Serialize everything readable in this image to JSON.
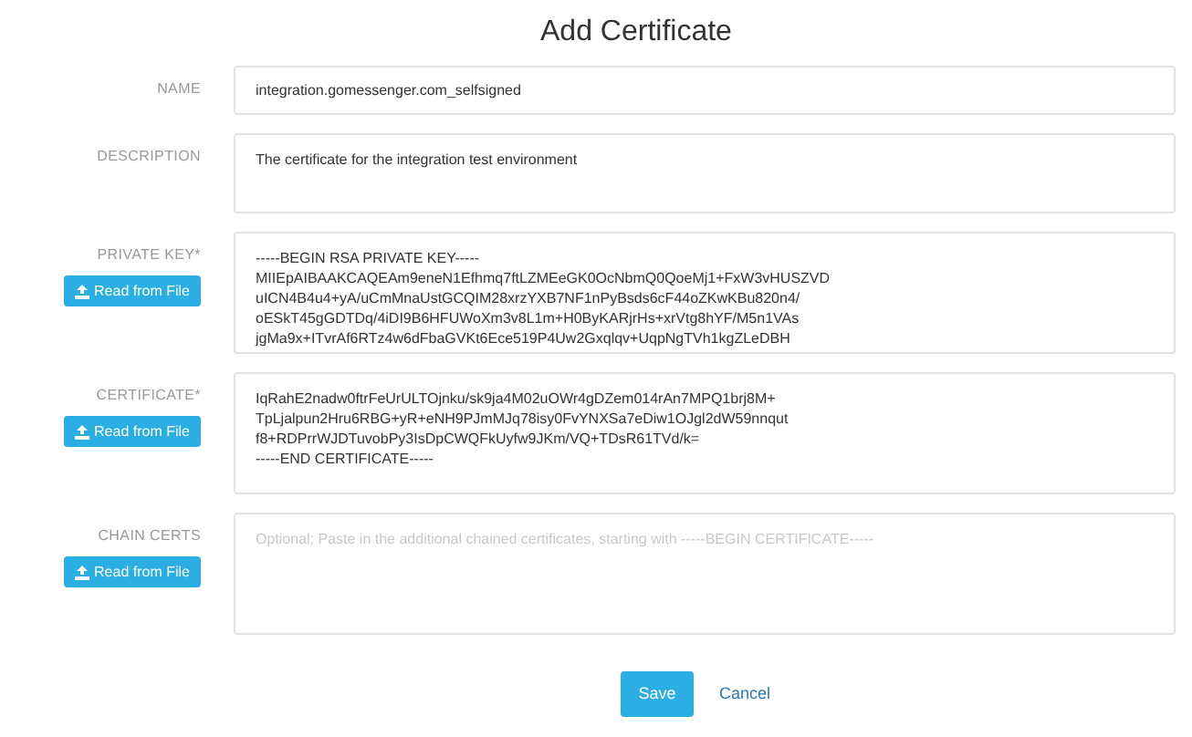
{
  "title": "Add Certificate",
  "fields": [
    {
      "label": "NAME",
      "kind": "line",
      "value": "integration.gomessenger.com_selfsigned"
    },
    {
      "label": "DESCRIPTION",
      "kind": "area",
      "value": "The certificate for the integration test environment"
    },
    {
      "label": "PRIVATE KEY*",
      "kind": "file",
      "button": "Read from File",
      "value": "-----BEGIN RSA PRIVATE KEY-----\nMIIEpAIBAAKCAQEAm9eneN1Efhmq7ftLZMEeGK0OcNbmQ0QoeMj1+FxW3vHUSZVD\nuICN4B4u4+yA/uCmMnaUstGCQIM28xrzYXB7NF1nPyBsds6cF44oZKwKBu820n4/\noESkT45gGDTDq/4iDI9B6HFUWoXm3v8L1m+H0ByKARjrHs+xrVtg8hYF/M5n1VAs\njgMa9x+ITvrAf6RTz4w6dFbaGVKt6Ece519P4Uw2Gxqlqv+UqpNgTVh1kgZLeDBH"
    },
    {
      "label": "CERTIFICATE*",
      "kind": "file",
      "button": "Read from File",
      "value": "IqRahE2nadw0ftrFeUrULTOjnku/sk9ja4M02uOWr4gDZem014rAn7MPQ1brj8M+\nTpLjalpun2Hru6RBG+yR+eNH9PJmMJq78isy0FvYNXSa7eDiw1OJgl2dW59nnqut\nf8+RDPrrWJDTuvobPy3IsDpCWQFkUyfw9JKm/VQ+TDsR61TVd/k=\n-----END CERTIFICATE-----"
    },
    {
      "label": "CHAIN CERTS",
      "kind": "file",
      "button": "Read from File",
      "placeholder": "Optional; Paste in the additional chained certificates, starting with -----BEGIN CERTIFICATE-----"
    }
  ],
  "save": "Save",
  "cancel": "Cancel"
}
